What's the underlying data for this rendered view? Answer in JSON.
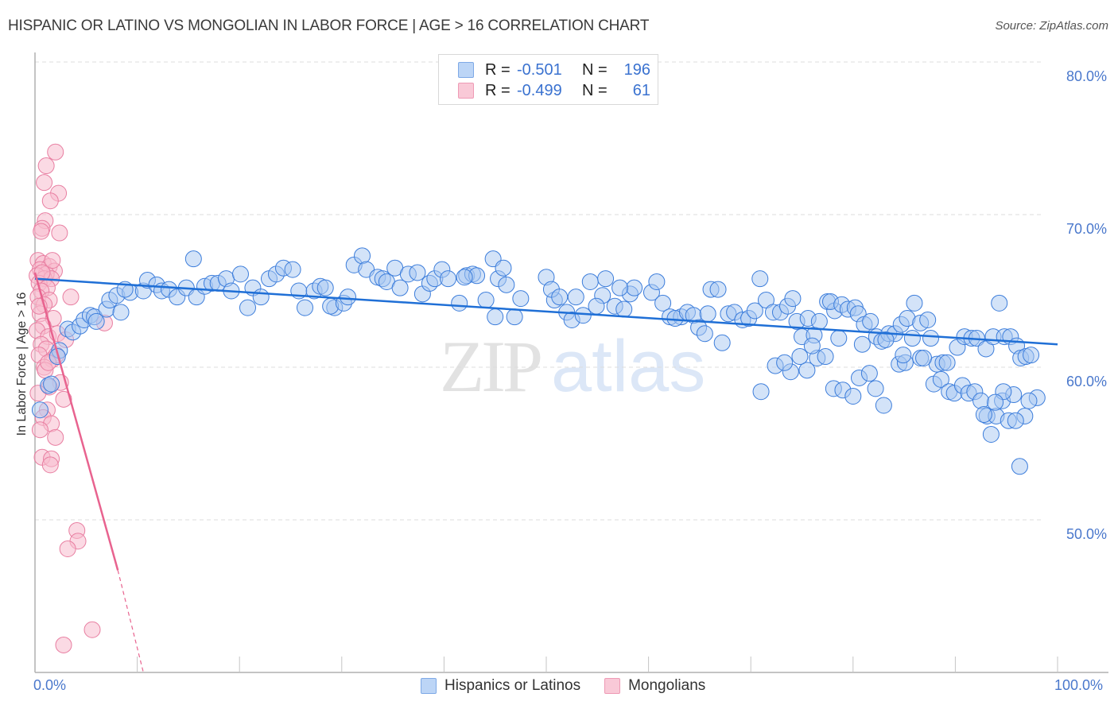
{
  "header": {
    "title": "HISPANIC OR LATINO VS MONGOLIAN IN LABOR FORCE | AGE > 16 CORRELATION CHART",
    "source": "Source: ZipAtlas.com"
  },
  "legend": {
    "series": [
      {
        "name": "Hispanics or Latinos",
        "r_label": "R =",
        "r_value": "-0.501",
        "n_label": "N =",
        "n_value": "196",
        "color": "#4a86e8"
      },
      {
        "name": "Mongolians",
        "r_label": "R =",
        "r_value": "-0.499",
        "n_label": "N =",
        "n_value": "61",
        "color": "#ee6f99"
      }
    ]
  },
  "watermark": {
    "zip": "ZIP",
    "atlas": "atlas"
  },
  "colors": {
    "blue_fill": "#a8c8f2",
    "blue_stroke": "#3c7ddb",
    "blue_line": "#1f6fd6",
    "pink_fill": "#f7bccd",
    "pink_stroke": "#e87ea1",
    "pink_line": "#e8638f",
    "tick_text": "#4a78cc"
  },
  "chart_data": {
    "type": "scatter",
    "title": "HISPANIC OR LATINO VS MONGOLIAN IN LABOR FORCE | AGE > 16 CORRELATION CHART",
    "xlabel": "",
    "ylabel": "In Labor Force | Age > 16",
    "xlim": [
      0,
      100
    ],
    "ylim": [
      40,
      82
    ],
    "x_tick_labels": [
      "0.0%",
      "100.0%"
    ],
    "y_ticks": [
      50,
      60,
      70,
      80
    ],
    "y_tick_labels": [
      "50.0%",
      "60.0%",
      "70.0%",
      "80.0%"
    ],
    "grid": true,
    "legend_position": "top-center",
    "series": [
      {
        "name": "Hispanics or Latinos",
        "r": -0.501,
        "n": 196,
        "trend": {
          "x0": 0,
          "y0": 65.8,
          "x1": 100,
          "y1": 61.5
        },
        "points": [
          [
            0.5,
            57.2
          ],
          [
            1.3,
            58.8
          ],
          [
            1.6,
            58.9
          ],
          [
            2.4,
            61.1
          ],
          [
            2.2,
            60.7
          ],
          [
            3.2,
            62.5
          ],
          [
            3.7,
            62.3
          ],
          [
            4.4,
            62.7
          ],
          [
            4.8,
            63.1
          ],
          [
            5.4,
            63.4
          ],
          [
            5.8,
            63.3
          ],
          [
            6.0,
            63.0
          ],
          [
            7.0,
            63.8
          ],
          [
            8.4,
            63.6
          ],
          [
            7.3,
            64.4
          ],
          [
            8.0,
            64.7
          ],
          [
            9.3,
            64.9
          ],
          [
            8.8,
            65.1
          ],
          [
            10.6,
            65.0
          ],
          [
            11.0,
            65.7
          ],
          [
            11.9,
            65.4
          ],
          [
            12.4,
            65.0
          ],
          [
            13.1,
            65.1
          ],
          [
            13.9,
            64.6
          ],
          [
            14.8,
            65.2
          ],
          [
            15.8,
            64.6
          ],
          [
            16.6,
            65.3
          ],
          [
            17.3,
            65.5
          ],
          [
            17.9,
            65.5
          ],
          [
            18.7,
            65.8
          ],
          [
            15.5,
            67.1
          ],
          [
            19.2,
            65.0
          ],
          [
            20.1,
            66.1
          ],
          [
            20.8,
            63.9
          ],
          [
            21.3,
            65.2
          ],
          [
            22.1,
            64.6
          ],
          [
            22.9,
            65.8
          ],
          [
            23.6,
            66.1
          ],
          [
            24.3,
            66.5
          ],
          [
            25.2,
            66.4
          ],
          [
            26.4,
            63.9
          ],
          [
            25.8,
            65.0
          ],
          [
            27.3,
            65.0
          ],
          [
            27.9,
            65.3
          ],
          [
            28.4,
            65.2
          ],
          [
            29.3,
            63.9
          ],
          [
            28.9,
            64.0
          ],
          [
            30.2,
            64.2
          ],
          [
            30.6,
            64.6
          ],
          [
            31.2,
            66.7
          ],
          [
            32.0,
            67.3
          ],
          [
            32.4,
            66.4
          ],
          [
            33.5,
            65.9
          ],
          [
            34.0,
            65.8
          ],
          [
            34.4,
            65.6
          ],
          [
            35.2,
            66.5
          ],
          [
            35.7,
            65.2
          ],
          [
            36.5,
            66.1
          ],
          [
            37.4,
            66.2
          ],
          [
            37.9,
            64.8
          ],
          [
            38.6,
            65.5
          ],
          [
            39.1,
            65.8
          ],
          [
            39.8,
            66.4
          ],
          [
            40.4,
            65.8
          ],
          [
            41.5,
            64.2
          ],
          [
            42.2,
            66.0
          ],
          [
            42.8,
            66.1
          ],
          [
            43.2,
            66.0
          ],
          [
            42.0,
            65.9
          ],
          [
            44.1,
            64.4
          ],
          [
            44.8,
            67.1
          ],
          [
            45.3,
            65.8
          ],
          [
            45.8,
            66.5
          ],
          [
            46.1,
            65.4
          ],
          [
            47.5,
            64.5
          ],
          [
            45.0,
            63.3
          ],
          [
            46.9,
            63.3
          ],
          [
            50.0,
            65.9
          ],
          [
            50.8,
            64.4
          ],
          [
            50.5,
            65.1
          ],
          [
            52.0,
            63.6
          ],
          [
            52.5,
            63.1
          ],
          [
            51.3,
            64.6
          ],
          [
            52.9,
            64.6
          ],
          [
            54.3,
            65.6
          ],
          [
            53.6,
            63.4
          ],
          [
            55.5,
            64.7
          ],
          [
            54.9,
            64.0
          ],
          [
            56.7,
            64.0
          ],
          [
            55.8,
            65.8
          ],
          [
            57.6,
            63.8
          ],
          [
            58.2,
            64.8
          ],
          [
            58.6,
            65.2
          ],
          [
            57.2,
            65.2
          ],
          [
            60.3,
            64.9
          ],
          [
            60.8,
            65.6
          ],
          [
            61.4,
            64.2
          ],
          [
            62.1,
            63.3
          ],
          [
            63.2,
            63.3
          ],
          [
            62.6,
            63.2
          ],
          [
            63.8,
            63.6
          ],
          [
            64.4,
            63.4
          ],
          [
            64.9,
            62.6
          ],
          [
            65.5,
            62.2
          ],
          [
            66.1,
            65.1
          ],
          [
            66.8,
            65.1
          ],
          [
            65.8,
            63.5
          ],
          [
            67.2,
            61.6
          ],
          [
            67.8,
            63.5
          ],
          [
            68.4,
            63.6
          ],
          [
            69.2,
            63.1
          ],
          [
            69.8,
            63.2
          ],
          [
            70.4,
            63.7
          ],
          [
            70.9,
            65.8
          ],
          [
            71.5,
            64.4
          ],
          [
            72.2,
            63.6
          ],
          [
            72.9,
            63.6
          ],
          [
            73.6,
            64.0
          ],
          [
            74.1,
            64.5
          ],
          [
            74.5,
            63.0
          ],
          [
            75.0,
            62.0
          ],
          [
            75.6,
            63.2
          ],
          [
            76.2,
            62.1
          ],
          [
            76.7,
            63.0
          ],
          [
            77.5,
            64.3
          ],
          [
            78.2,
            63.7
          ],
          [
            77.8,
            64.3
          ],
          [
            78.9,
            64.1
          ],
          [
            79.5,
            63.8
          ],
          [
            80.2,
            63.9
          ],
          [
            80.5,
            63.5
          ],
          [
            81.1,
            62.8
          ],
          [
            81.7,
            63.0
          ],
          [
            82.3,
            62.0
          ],
          [
            82.8,
            61.7
          ],
          [
            83.5,
            62.2
          ],
          [
            84.1,
            62.2
          ],
          [
            84.7,
            62.8
          ],
          [
            85.3,
            63.2
          ],
          [
            86.0,
            64.2
          ],
          [
            86.6,
            62.9
          ],
          [
            87.3,
            63.1
          ],
          [
            87.6,
            61.9
          ],
          [
            88.2,
            60.2
          ],
          [
            88.8,
            60.3
          ],
          [
            89.2,
            60.3
          ],
          [
            90.2,
            61.3
          ],
          [
            90.9,
            62.0
          ],
          [
            91.6,
            61.9
          ],
          [
            92.1,
            61.9
          ],
          [
            93.0,
            61.2
          ],
          [
            93.7,
            62.0
          ],
          [
            94.3,
            64.2
          ],
          [
            94.8,
            62.0
          ],
          [
            95.4,
            62.0
          ],
          [
            96.0,
            61.4
          ],
          [
            96.4,
            60.6
          ],
          [
            96.9,
            60.7
          ],
          [
            97.4,
            60.8
          ],
          [
            98.0,
            58.0
          ],
          [
            71.0,
            58.4
          ],
          [
            73.9,
            59.7
          ],
          [
            75.5,
            59.8
          ],
          [
            76.5,
            60.6
          ],
          [
            77.3,
            60.7
          ],
          [
            78.1,
            58.6
          ],
          [
            79.0,
            58.5
          ],
          [
            80.0,
            58.1
          ],
          [
            80.6,
            59.3
          ],
          [
            81.6,
            59.6
          ],
          [
            82.2,
            58.6
          ],
          [
            83.0,
            57.5
          ],
          [
            84.5,
            60.2
          ],
          [
            85.1,
            60.3
          ],
          [
            86.6,
            60.6
          ],
          [
            87.9,
            58.9
          ],
          [
            88.6,
            59.2
          ],
          [
            89.4,
            58.4
          ],
          [
            89.9,
            58.3
          ],
          [
            90.7,
            58.8
          ],
          [
            91.3,
            58.3
          ],
          [
            91.9,
            58.4
          ],
          [
            92.5,
            57.8
          ],
          [
            93.1,
            56.8
          ],
          [
            93.5,
            55.6
          ],
          [
            94.0,
            56.8
          ],
          [
            94.6,
            57.8
          ],
          [
            95.2,
            56.5
          ],
          [
            95.7,
            58.2
          ],
          [
            96.3,
            53.5
          ],
          [
            72.4,
            60.1
          ],
          [
            73.3,
            60.3
          ],
          [
            74.8,
            60.7
          ],
          [
            76.0,
            61.4
          ],
          [
            78.6,
            61.9
          ],
          [
            80.9,
            61.5
          ],
          [
            83.2,
            61.8
          ],
          [
            84.9,
            60.8
          ],
          [
            85.8,
            61.9
          ],
          [
            86.9,
            60.6
          ],
          [
            96.8,
            56.8
          ],
          [
            97.2,
            57.8
          ],
          [
            95.9,
            56.5
          ],
          [
            94.7,
            58.4
          ],
          [
            93.9,
            57.7
          ],
          [
            92.8,
            56.9
          ]
        ]
      },
      {
        "name": "Mongolians",
        "r": -0.499,
        "n": 61,
        "trend": {
          "x0": 0,
          "y0": 66.2,
          "x1": 8.1,
          "y1": 46.7,
          "dashed_to": {
            "x": 10.6,
            "y": 40
          }
        },
        "points": [
          [
            2.0,
            74.1
          ],
          [
            1.1,
            73.2
          ],
          [
            0.9,
            72.1
          ],
          [
            2.3,
            71.4
          ],
          [
            1.5,
            70.9
          ],
          [
            1.0,
            69.6
          ],
          [
            0.7,
            69.1
          ],
          [
            0.6,
            68.9
          ],
          [
            2.4,
            68.8
          ],
          [
            0.3,
            67.0
          ],
          [
            0.8,
            66.8
          ],
          [
            1.4,
            66.6
          ],
          [
            1.9,
            66.3
          ],
          [
            0.5,
            66.4
          ],
          [
            1.1,
            66.1
          ],
          [
            0.2,
            66.0
          ],
          [
            0.9,
            65.8
          ],
          [
            1.6,
            65.8
          ],
          [
            0.4,
            65.5
          ],
          [
            1.2,
            65.2
          ],
          [
            0.6,
            65.0
          ],
          [
            0.3,
            64.6
          ],
          [
            1.4,
            64.4
          ],
          [
            0.9,
            64.1
          ],
          [
            3.5,
            64.6
          ],
          [
            0.5,
            63.5
          ],
          [
            1.8,
            63.2
          ],
          [
            0.8,
            62.7
          ],
          [
            6.8,
            62.9
          ],
          [
            0.2,
            62.4
          ],
          [
            1.3,
            62.0
          ],
          [
            0.6,
            61.5
          ],
          [
            1.1,
            61.2
          ],
          [
            0.4,
            60.8
          ],
          [
            1.7,
            60.5
          ],
          [
            2.1,
            60.8
          ],
          [
            0.9,
            60.0
          ],
          [
            2.5,
            59.0
          ],
          [
            1.4,
            58.7
          ],
          [
            0.3,
            58.3
          ],
          [
            2.8,
            57.9
          ],
          [
            1.2,
            57.2
          ],
          [
            0.8,
            56.7
          ],
          [
            1.6,
            56.3
          ],
          [
            0.5,
            55.9
          ],
          [
            2.0,
            55.4
          ],
          [
            0.7,
            54.1
          ],
          [
            1.6,
            54.0
          ],
          [
            1.5,
            53.6
          ],
          [
            4.1,
            49.3
          ],
          [
            4.2,
            48.6
          ],
          [
            3.2,
            48.1
          ],
          [
            5.6,
            42.8
          ],
          [
            2.8,
            41.8
          ],
          [
            1.0,
            59.8
          ],
          [
            2.2,
            62.2
          ],
          [
            1.7,
            67.0
          ],
          [
            0.4,
            64.0
          ],
          [
            3.0,
            61.8
          ],
          [
            1.3,
            60.3
          ],
          [
            0.7,
            66.2
          ]
        ]
      }
    ]
  }
}
